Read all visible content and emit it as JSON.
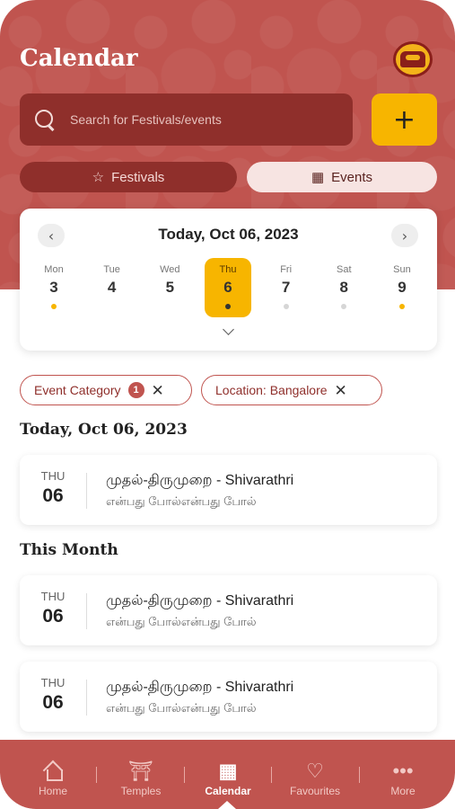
{
  "page": {
    "title": "Calendar"
  },
  "search": {
    "placeholder": "Search for Festivals/events",
    "add_label": "+"
  },
  "tabs": [
    {
      "label": "Festivals",
      "icon": "star-icon",
      "active": false
    },
    {
      "label": "Events",
      "icon": "calendar-icon",
      "active": true
    }
  ],
  "calendar": {
    "current_date": "Today, Oct 06, 2023",
    "prev_icon": "‹",
    "next_icon": "›",
    "days": [
      {
        "name": "Mon",
        "num": "3",
        "dot": "#f7b500"
      },
      {
        "name": "Tue",
        "num": "4",
        "dot": ""
      },
      {
        "name": "Wed",
        "num": "5",
        "dot": ""
      },
      {
        "name": "Thu",
        "num": "6",
        "dot": "#333333",
        "active": true
      },
      {
        "name": "Fri",
        "num": "7",
        "dot": "#d6d6d6"
      },
      {
        "name": "Sat",
        "num": "8",
        "dot": "#d6d6d6"
      },
      {
        "name": "Sun",
        "num": "9",
        "dot": "#f7b500"
      }
    ]
  },
  "filters": {
    "category_label": "Event Category",
    "category_count": "1",
    "location_label": "Location: Bangalore",
    "close_glyph": "✕"
  },
  "sections": {
    "today_title": "Today, Oct 06, 2023",
    "month_title": "This Month"
  },
  "events": {
    "today": [
      {
        "day": "THU",
        "date": "06",
        "title": "முதல்-திருமுறை - Shivarathri",
        "subtitle": "என்பது போல்என்பது போல்"
      }
    ],
    "month": [
      {
        "day": "THU",
        "date": "06",
        "title": "முதல்-திருமுறை - Shivarathri",
        "subtitle": "என்பது போல்என்பது போல்"
      },
      {
        "day": "THU",
        "date": "06",
        "title": "முதல்-திருமுறை - Shivarathri",
        "subtitle": "என்பது போல்என்பது போல்"
      }
    ]
  },
  "bottom_nav": [
    {
      "label": "Home",
      "icon": "home-icon",
      "active": false
    },
    {
      "label": "Temples",
      "icon": "temple-icon",
      "active": false
    },
    {
      "label": "Calendar",
      "icon": "calendar-icon",
      "active": true
    },
    {
      "label": "Favourites",
      "icon": "heart-icon",
      "active": false
    },
    {
      "label": "More",
      "icon": "more-icon",
      "active": false
    }
  ],
  "colors": {
    "brand": "#c0544f",
    "brand_dark": "#8f2f2b",
    "accent": "#f7b500"
  }
}
